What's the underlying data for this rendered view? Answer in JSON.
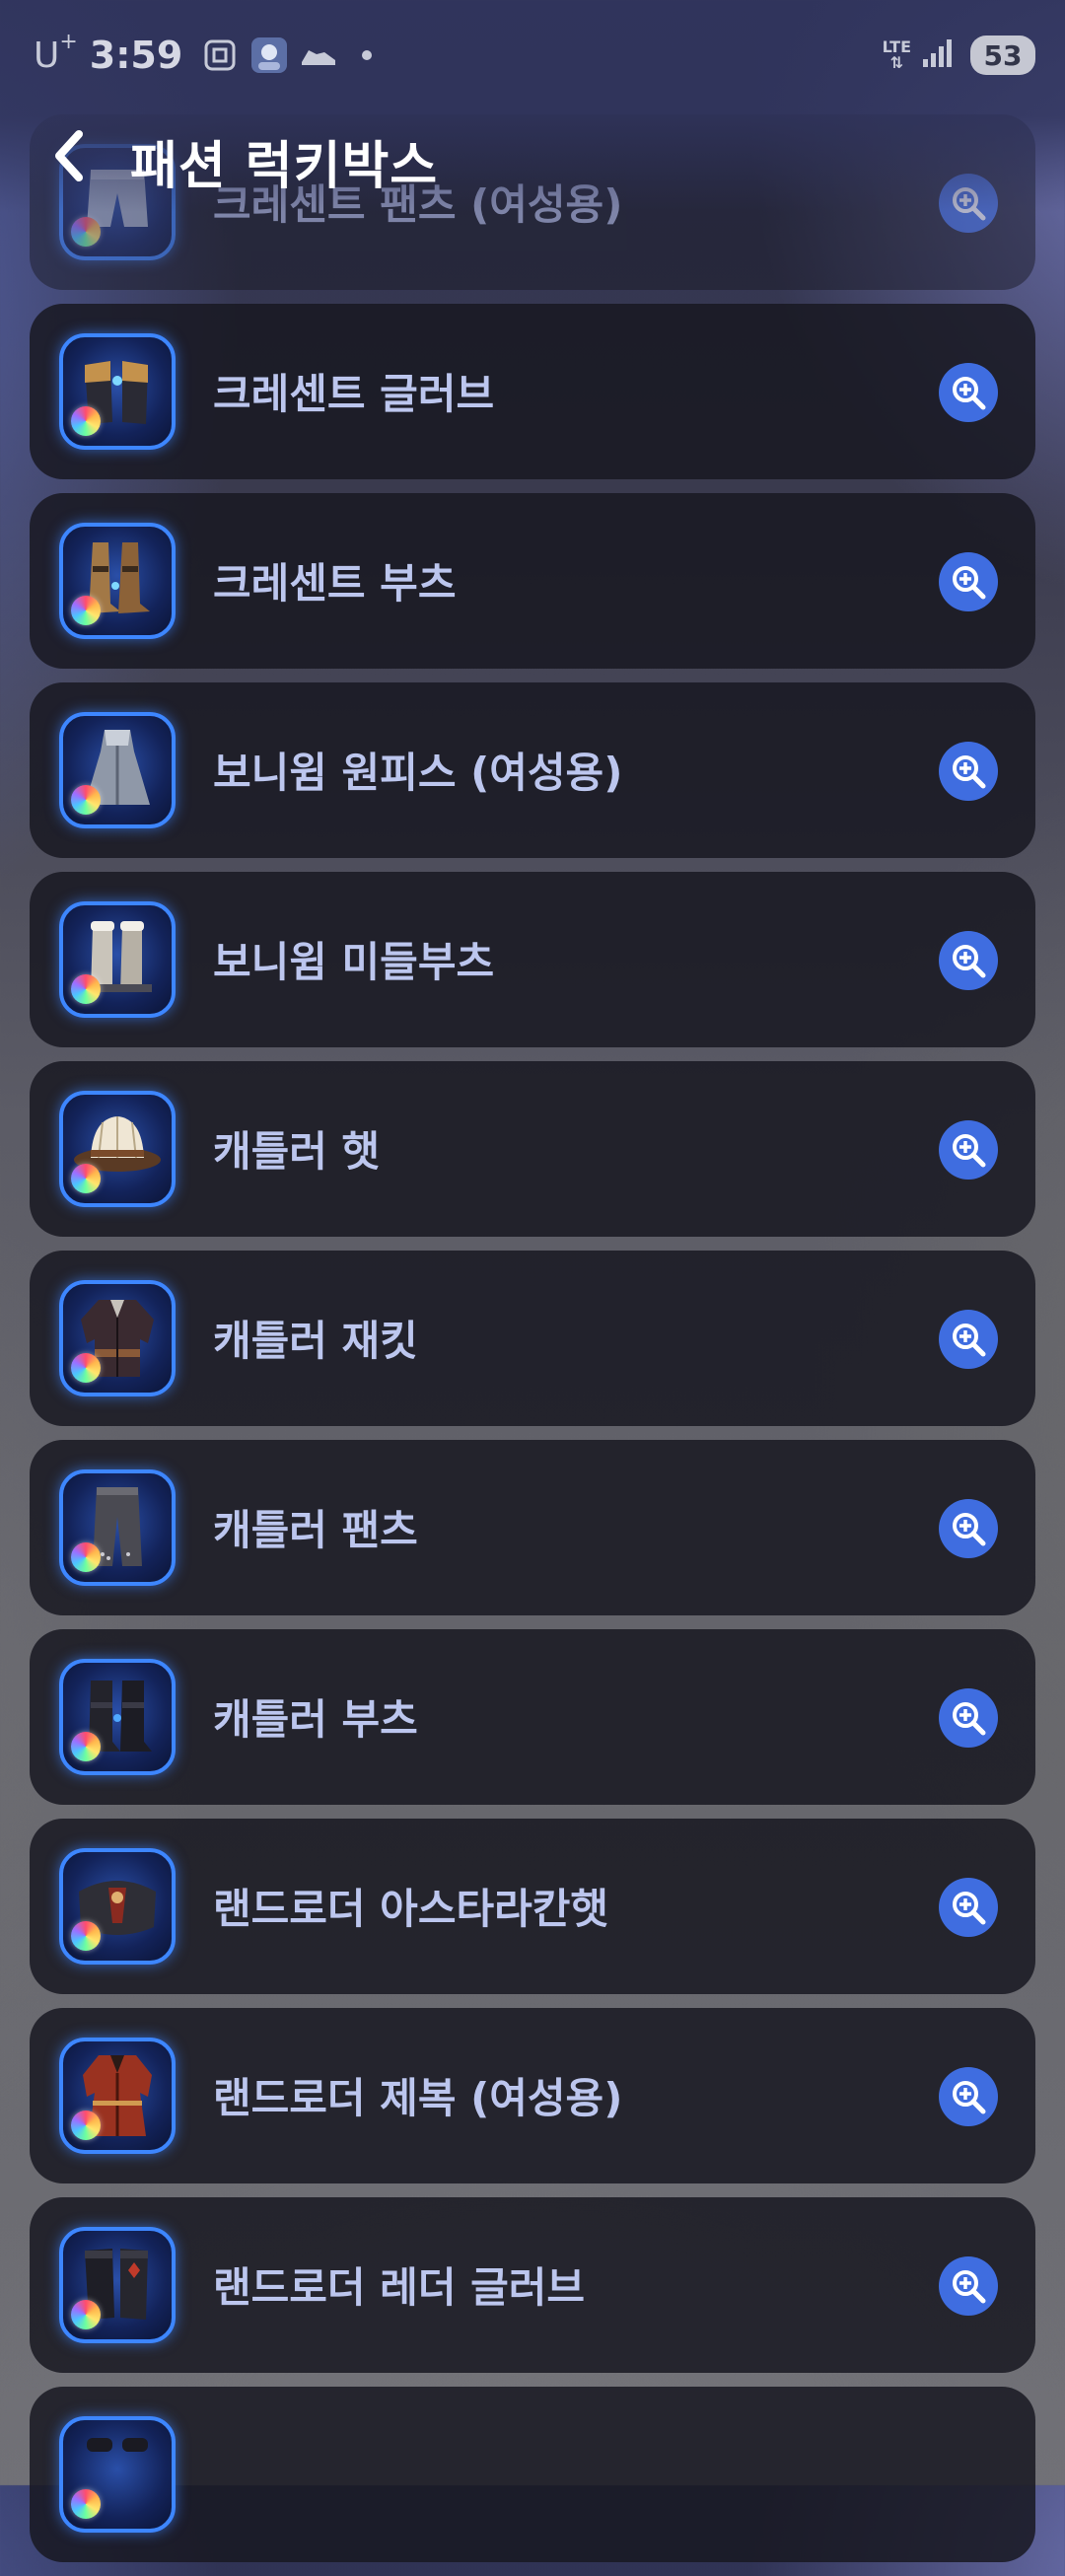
{
  "status_bar": {
    "carrier": "U",
    "carrier_sup": "+",
    "time": "3:59",
    "network": "LTE",
    "battery": "53"
  },
  "header": {
    "title": "패션 럭키박스"
  },
  "items": [
    {
      "label": "크레센트 팬츠 (여성용)",
      "icon": "pants-icon"
    },
    {
      "label": "크레센트 글러브",
      "icon": "gloves-icon"
    },
    {
      "label": "크레센트 부츠",
      "icon": "boots-icon"
    },
    {
      "label": "보니윔 원피스 (여성용)",
      "icon": "dress-icon"
    },
    {
      "label": "보니윔 미들부츠",
      "icon": "boots-icon"
    },
    {
      "label": "캐틀러 햇",
      "icon": "hat-icon"
    },
    {
      "label": "캐틀러 재킷",
      "icon": "jacket-icon"
    },
    {
      "label": "캐틀러 팬츠",
      "icon": "pants-icon"
    },
    {
      "label": "캐틀러 부츠",
      "icon": "boots-icon"
    },
    {
      "label": "랜드로더 아스타라칸햇",
      "icon": "hat-icon"
    },
    {
      "label": "랜드로더 제복 (여성용)",
      "icon": "jacket-icon"
    },
    {
      "label": "랜드로더 레더 글러브",
      "icon": "gloves-icon"
    },
    {
      "label": "",
      "icon": "boots-icon"
    }
  ],
  "colors": {
    "accent": "#3f6de0",
    "thumb_border": "#3d86ff",
    "label": "#bcc6ee",
    "card": "#181822"
  }
}
